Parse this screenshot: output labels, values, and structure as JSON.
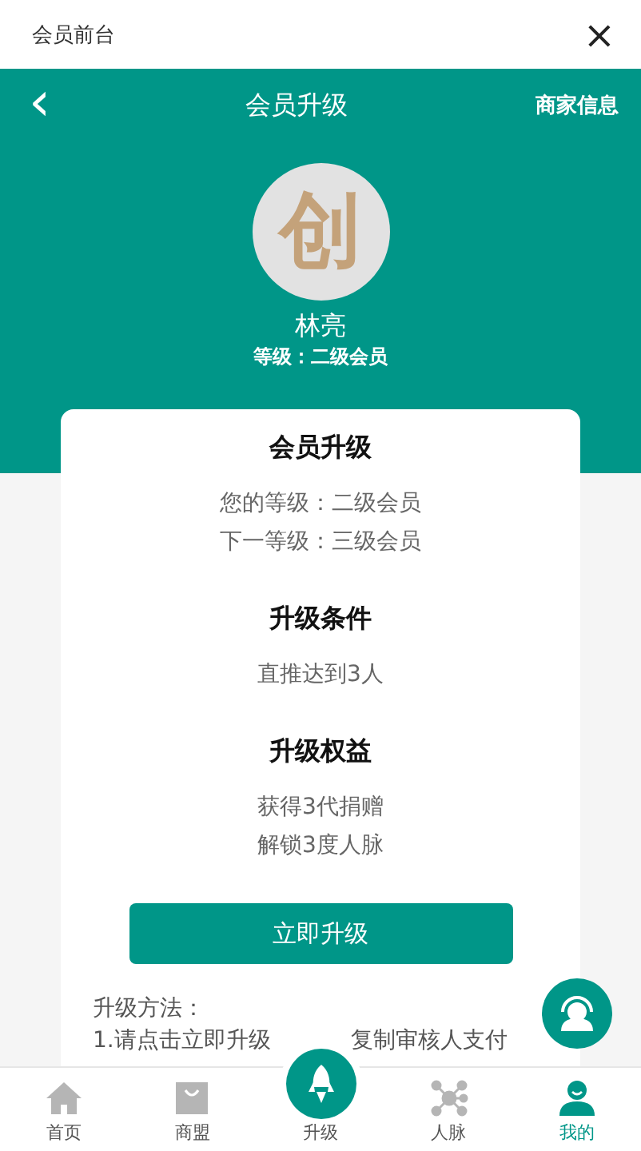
{
  "window": {
    "title": "会员前台",
    "close": "×"
  },
  "header": {
    "back": "‹",
    "title": "会员升级",
    "action": "商家信息"
  },
  "profile": {
    "avatar_text": "创",
    "name": "林亮",
    "level": "等级：二级会员"
  },
  "card": {
    "title": "会员升级",
    "lines": [
      "您的等级：二级会员",
      "下一等级：三级会员"
    ],
    "sections": [
      {
        "title": "升级条件",
        "lines": [
          "直推达到3人"
        ]
      },
      {
        "title": "升级权益",
        "lines": [
          "获得3代捐赠",
          "解锁3度人脉"
        ]
      }
    ],
    "button": "立即升级",
    "method_title": "升级方法：",
    "method_line_parts": [
      "1.请点击立即升级",
      "复制审核人支付"
    ]
  },
  "bottom_nav": [
    {
      "label": "首页",
      "kind": "tab",
      "selected": false
    },
    {
      "label": "商盟",
      "kind": "tab",
      "selected": false
    },
    {
      "label": "升级",
      "kind": "raised",
      "selected": false
    },
    {
      "label": "人脉",
      "kind": "tab",
      "selected": false
    },
    {
      "label": "我的",
      "kind": "tab",
      "selected": true
    }
  ]
}
